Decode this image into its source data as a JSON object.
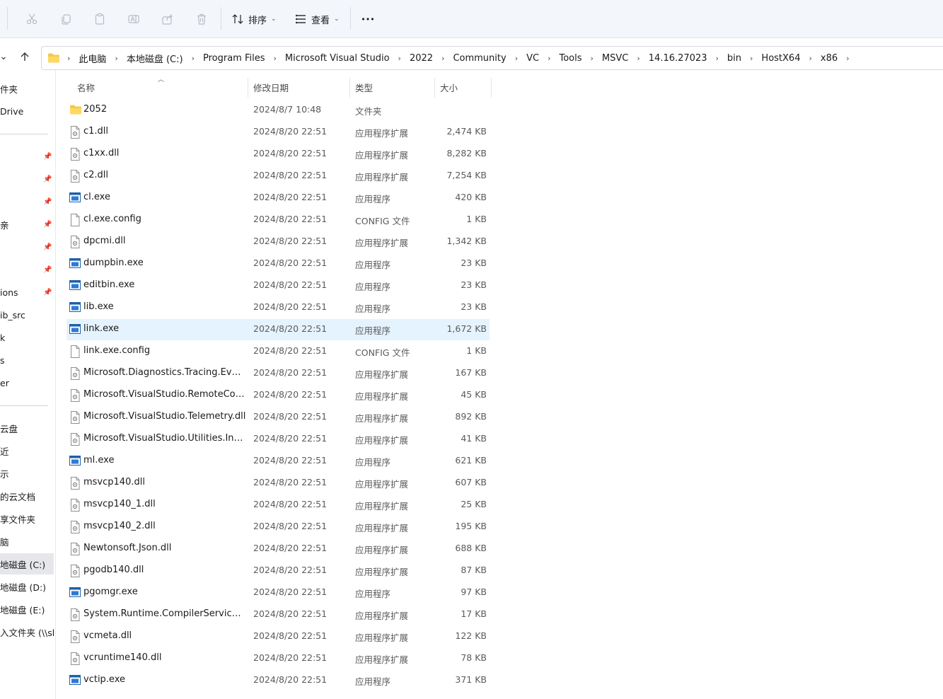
{
  "toolbar": {
    "sort_label": "排序",
    "view_label": "查看",
    "more_label": "•••"
  },
  "address": {
    "crumbs": [
      "此电脑",
      "本地磁盘 (C:)",
      "Program Files",
      "Microsoft Visual Studio",
      "2022",
      "Community",
      "VC",
      "Tools",
      "MSVC",
      "14.16.27023",
      "bin",
      "HostX64",
      "x86"
    ]
  },
  "sidebar": {
    "items": [
      "件夹",
      "Drive",
      "",
      "",
      "",
      "亲",
      "",
      "",
      "ions",
      "ib_src",
      "k",
      "s",
      "er",
      "云盘",
      "近",
      "示",
      "的云文档",
      "享文件夹",
      "脑",
      "地磁盘 (C:)",
      "地磁盘 (D:)",
      "地磁盘 (E:)",
      "入文件夹 (\\\\sha"
    ]
  },
  "columns": {
    "name": "名称",
    "date": "修改日期",
    "type": "类型",
    "size": "大小"
  },
  "files": [
    {
      "name": "2052",
      "date": "2024/8/7 10:48",
      "type": "文件夹",
      "size": "",
      "icon": "folder"
    },
    {
      "name": "c1.dll",
      "date": "2024/8/20 22:51",
      "type": "应用程序扩展",
      "size": "2,474 KB",
      "icon": "dll"
    },
    {
      "name": "c1xx.dll",
      "date": "2024/8/20 22:51",
      "type": "应用程序扩展",
      "size": "8,282 KB",
      "icon": "dll"
    },
    {
      "name": "c2.dll",
      "date": "2024/8/20 22:51",
      "type": "应用程序扩展",
      "size": "7,254 KB",
      "icon": "dll"
    },
    {
      "name": "cl.exe",
      "date": "2024/8/20 22:51",
      "type": "应用程序",
      "size": "420 KB",
      "icon": "exe"
    },
    {
      "name": "cl.exe.config",
      "date": "2024/8/20 22:51",
      "type": "CONFIG 文件",
      "size": "1 KB",
      "icon": "file"
    },
    {
      "name": "dpcmi.dll",
      "date": "2024/8/20 22:51",
      "type": "应用程序扩展",
      "size": "1,342 KB",
      "icon": "dll"
    },
    {
      "name": "dumpbin.exe",
      "date": "2024/8/20 22:51",
      "type": "应用程序",
      "size": "23 KB",
      "icon": "exe"
    },
    {
      "name": "editbin.exe",
      "date": "2024/8/20 22:51",
      "type": "应用程序",
      "size": "23 KB",
      "icon": "exe"
    },
    {
      "name": "lib.exe",
      "date": "2024/8/20 22:51",
      "type": "应用程序",
      "size": "23 KB",
      "icon": "exe"
    },
    {
      "name": "link.exe",
      "date": "2024/8/20 22:51",
      "type": "应用程序",
      "size": "1,672 KB",
      "icon": "exe"
    },
    {
      "name": "link.exe.config",
      "date": "2024/8/20 22:51",
      "type": "CONFIG 文件",
      "size": "1 KB",
      "icon": "file"
    },
    {
      "name": "Microsoft.Diagnostics.Tracing.EventS...",
      "date": "2024/8/20 22:51",
      "type": "应用程序扩展",
      "size": "167 KB",
      "icon": "dll"
    },
    {
      "name": "Microsoft.VisualStudio.RemoteContr...",
      "date": "2024/8/20 22:51",
      "type": "应用程序扩展",
      "size": "45 KB",
      "icon": "dll"
    },
    {
      "name": "Microsoft.VisualStudio.Telemetry.dll",
      "date": "2024/8/20 22:51",
      "type": "应用程序扩展",
      "size": "892 KB",
      "icon": "dll"
    },
    {
      "name": "Microsoft.VisualStudio.Utilities.Intern...",
      "date": "2024/8/20 22:51",
      "type": "应用程序扩展",
      "size": "41 KB",
      "icon": "dll"
    },
    {
      "name": "ml.exe",
      "date": "2024/8/20 22:51",
      "type": "应用程序",
      "size": "621 KB",
      "icon": "exe"
    },
    {
      "name": "msvcp140.dll",
      "date": "2024/8/20 22:51",
      "type": "应用程序扩展",
      "size": "607 KB",
      "icon": "dll"
    },
    {
      "name": "msvcp140_1.dll",
      "date": "2024/8/20 22:51",
      "type": "应用程序扩展",
      "size": "25 KB",
      "icon": "dll"
    },
    {
      "name": "msvcp140_2.dll",
      "date": "2024/8/20 22:51",
      "type": "应用程序扩展",
      "size": "195 KB",
      "icon": "dll"
    },
    {
      "name": "Newtonsoft.Json.dll",
      "date": "2024/8/20 22:51",
      "type": "应用程序扩展",
      "size": "688 KB",
      "icon": "dll"
    },
    {
      "name": "pgodb140.dll",
      "date": "2024/8/20 22:51",
      "type": "应用程序扩展",
      "size": "87 KB",
      "icon": "dll"
    },
    {
      "name": "pgomgr.exe",
      "date": "2024/8/20 22:51",
      "type": "应用程序",
      "size": "97 KB",
      "icon": "exe"
    },
    {
      "name": "System.Runtime.CompilerServices.Un...",
      "date": "2024/8/20 22:51",
      "type": "应用程序扩展",
      "size": "17 KB",
      "icon": "dll"
    },
    {
      "name": "vcmeta.dll",
      "date": "2024/8/20 22:51",
      "type": "应用程序扩展",
      "size": "122 KB",
      "icon": "dll"
    },
    {
      "name": "vcruntime140.dll",
      "date": "2024/8/20 22:51",
      "type": "应用程序扩展",
      "size": "78 KB",
      "icon": "dll"
    },
    {
      "name": "vctip.exe",
      "date": "2024/8/20 22:51",
      "type": "应用程序",
      "size": "371 KB",
      "icon": "exe"
    }
  ],
  "selected_file": "link.exe",
  "selected_sidebar": "地磁盘 (C:)"
}
